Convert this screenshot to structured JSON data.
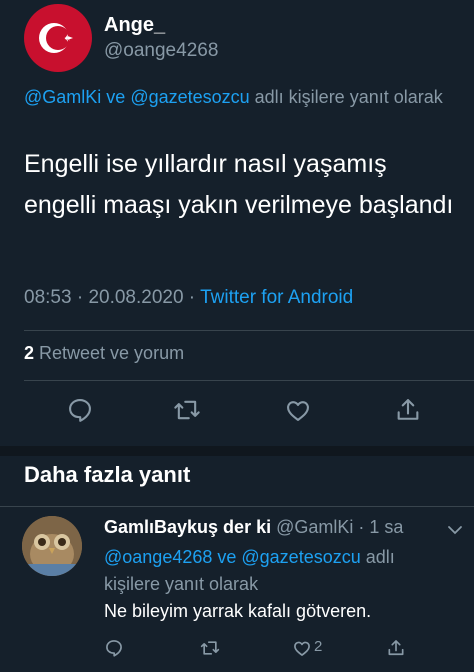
{
  "tweet": {
    "author_name": "Ange_",
    "author_handle": "@oange4268",
    "reply_to": {
      "mention1": "@GamlKi",
      "joiner": " ve ",
      "mention2": "@gazetesozcu",
      "suffix": " adlı kişilere yanıt olarak"
    },
    "text": "Engelli ise yıllardır nasıl yaşamış engelli maaşı yakın verilmeye başlandı",
    "time": "08:53",
    "sep": " · ",
    "date": "20.08.2020",
    "sep2": " · ",
    "source": "Twitter for Android",
    "retweet_count": "2",
    "retweet_label": " Retweet ve yorum",
    "actions": [
      "reply-icon",
      "retweet-icon",
      "like-icon",
      "share-icon"
    ]
  },
  "section": {
    "title": "Daha fazla yanıt"
  },
  "reply": {
    "name": "GamlıBaykuş der ki",
    "handle": " @GamlKi",
    "time": " · 1 sa",
    "reply_to": {
      "mention1": "@oange4268",
      "joiner": " ve ",
      "mention2": "@gazetesozcu",
      "suffix": " adlı kişilere yanıt olarak"
    },
    "text": "Ne bileyim yarrak kafalı götveren.",
    "like_count": "2"
  },
  "colors": {
    "background": "#15202b",
    "accent": "#1da1f2",
    "muted": "#8899a6",
    "divider": "#38444d",
    "flag_red": "#c8102e"
  }
}
